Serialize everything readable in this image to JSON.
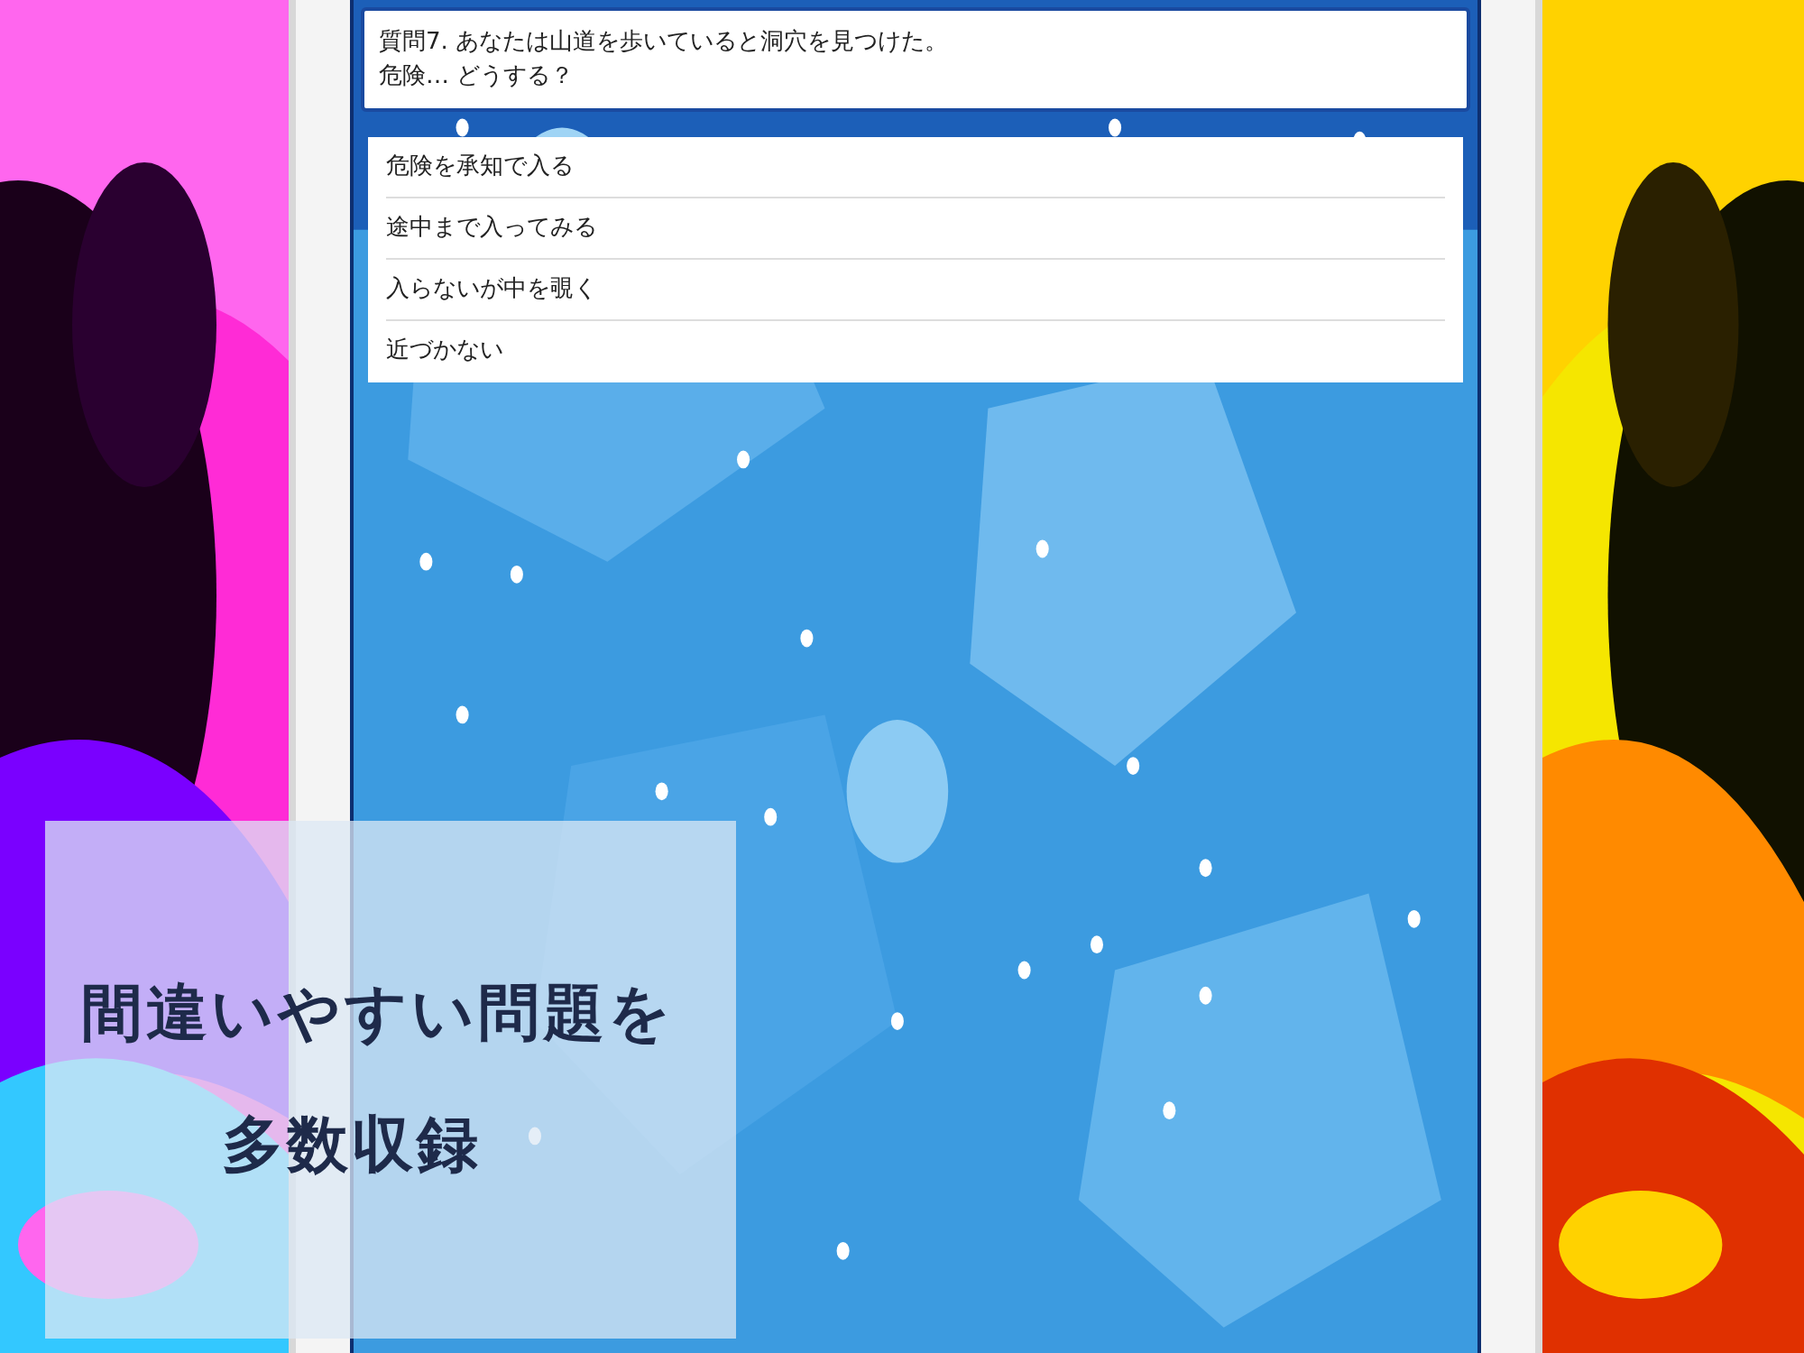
{
  "question": {
    "lines": [
      "質問7. あなたは山道を歩いていると洞穴を見つけた。",
      "危険… どうする？"
    ]
  },
  "options": [
    {
      "label": "危険を承知で入る"
    },
    {
      "label": "途中まで入ってみる"
    },
    {
      "label": "入らないが中を覗く"
    },
    {
      "label": "近づかない"
    }
  ],
  "caption": {
    "lines": [
      "間違いやすい問題を",
      "多数収録"
    ]
  }
}
